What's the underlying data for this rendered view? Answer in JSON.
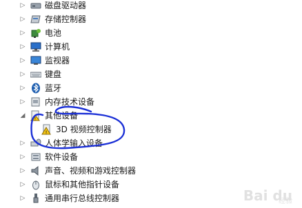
{
  "device_tree": {
    "items": [
      {
        "label": "磁盘驱动器",
        "icon": "disk-drive-icon",
        "expanded": false
      },
      {
        "label": "存储控制器",
        "icon": "storage-controller-icon",
        "expanded": false
      },
      {
        "label": "电池",
        "icon": "battery-icon",
        "expanded": false
      },
      {
        "label": "计算机",
        "icon": "computer-icon",
        "expanded": false
      },
      {
        "label": "监视器",
        "icon": "monitor-icon",
        "expanded": false
      },
      {
        "label": "键盘",
        "icon": "keyboard-icon",
        "expanded": false
      },
      {
        "label": "蓝牙",
        "icon": "bluetooth-icon",
        "expanded": false
      },
      {
        "label": "内存技术设备",
        "icon": "memory-device-icon",
        "expanded": false
      },
      {
        "label": "其他设备",
        "icon": "other-devices-warning-icon",
        "expanded": true
      },
      {
        "label": "3D 视频控制器",
        "icon": "warning-device-icon",
        "child": true
      },
      {
        "label": "人体学输入设备",
        "icon": "hid-icon",
        "expanded": false
      },
      {
        "label": "软件设备",
        "icon": "software-device-icon",
        "expanded": false
      },
      {
        "label": "声音、视频和游戏控制器",
        "icon": "audio-icon",
        "expanded": false
      },
      {
        "label": "鼠标和其他指针设备",
        "icon": "mouse-icon",
        "expanded": false
      },
      {
        "label": "通用串行总线控制器",
        "icon": "usb-icon",
        "expanded": false
      }
    ]
  },
  "watermark": {
    "brand": "Bai du",
    "sub": "经验"
  },
  "colors": {
    "annotation": "#1a2fd6",
    "warning": "#f5c518",
    "expander": "#6b6b6b"
  }
}
